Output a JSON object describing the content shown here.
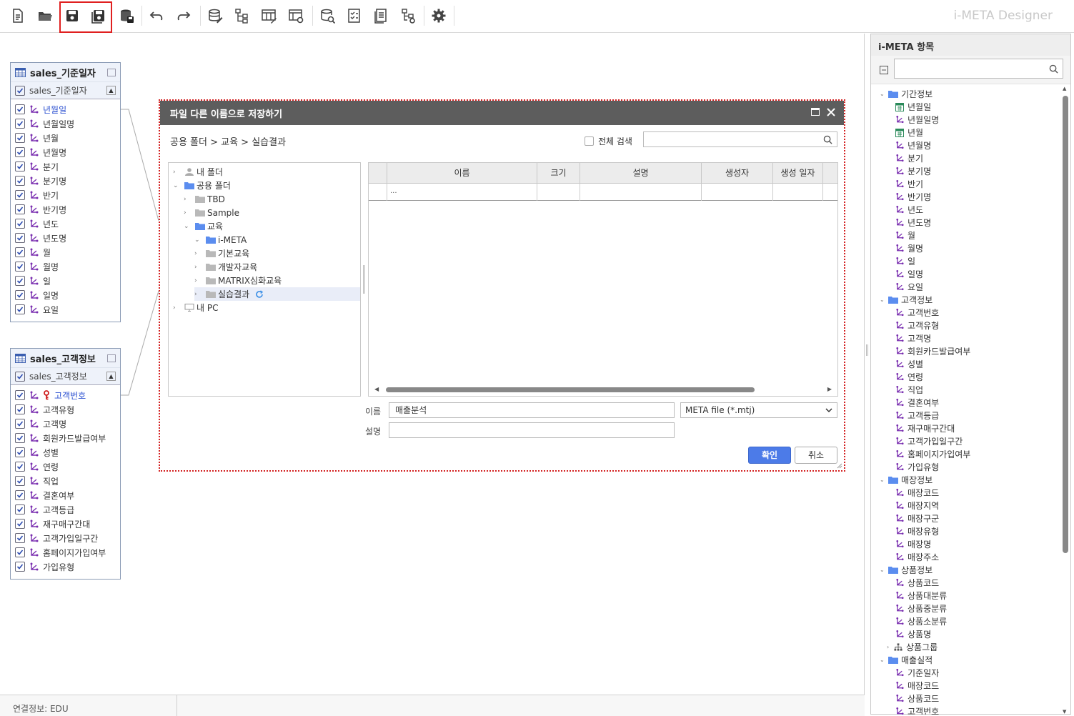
{
  "app": {
    "title": "i-META Designer"
  },
  "toolbar": {
    "buttons": [
      {
        "name": "new-file-icon"
      },
      {
        "name": "open-folder-icon"
      },
      {
        "name": "save-icon"
      },
      {
        "name": "save-as-icon"
      },
      {
        "name": "save-db-icon"
      },
      {
        "name": "undo-icon"
      },
      {
        "name": "redo-icon"
      },
      {
        "name": "database-edit-icon"
      },
      {
        "name": "hierarchy-icon"
      },
      {
        "name": "table-edit-icon"
      },
      {
        "name": "table-settings-icon"
      },
      {
        "name": "db-search-icon"
      },
      {
        "name": "checklist-icon"
      },
      {
        "name": "document-icon"
      },
      {
        "name": "tree-settings-icon"
      },
      {
        "name": "gear-icon"
      }
    ]
  },
  "entities": [
    {
      "title": "sales_기준일자",
      "subtitle": "sales_기준일자",
      "fields": [
        "년월일",
        "년월일명",
        "년월",
        "년월명",
        "분기",
        "분기명",
        "반기",
        "반기명",
        "년도",
        "년도명",
        "월",
        "월명",
        "일",
        "일명",
        "요일"
      ]
    },
    {
      "title": "sales_고객정보",
      "subtitle": "sales_고객정보",
      "fields": [
        "고객번호",
        "고객유형",
        "고객명",
        "회원카드발급여부",
        "성별",
        "연령",
        "직업",
        "결혼여부",
        "고객등급",
        "재구매구간대",
        "고객가입일구간",
        "홈페이지가입여부",
        "가입유형"
      ]
    }
  ],
  "dialog": {
    "title": "파일 다른 이름으로 저장하기",
    "path": "공용 폴더 > 교육 > 실습결과",
    "full_search_label": "전체 검색",
    "tree": [
      {
        "label": "내 폴더",
        "level": 0,
        "chev": "›",
        "icon": "user"
      },
      {
        "label": "공용 폴더",
        "level": 0,
        "chev": "⌄",
        "icon": "folder-blue"
      },
      {
        "label": "TBD",
        "level": 1,
        "chev": "›",
        "icon": "folder-gray"
      },
      {
        "label": "Sample",
        "level": 1,
        "chev": "›",
        "icon": "folder-gray"
      },
      {
        "label": "교육",
        "level": 1,
        "chev": "⌄",
        "icon": "folder-blue"
      },
      {
        "label": "i-META",
        "level": 2,
        "chev": "⌄",
        "icon": "folder-blue"
      },
      {
        "label": "기본교육",
        "level": 2,
        "chev": "›",
        "icon": "folder-gray"
      },
      {
        "label": "개발자교육",
        "level": 2,
        "chev": "›",
        "icon": "folder-gray"
      },
      {
        "label": "MATRIX심화교육",
        "level": 2,
        "chev": "›",
        "icon": "folder-gray"
      },
      {
        "label": "실습결과",
        "level": 2,
        "chev": "›",
        "icon": "folder-gray",
        "selected": true
      },
      {
        "label": "내 PC",
        "level": 0,
        "chev": "›",
        "icon": "pc"
      }
    ],
    "grid": {
      "columns": [
        "이름",
        "크기",
        "설명",
        "생성자",
        "생성 일자"
      ],
      "parent_row": "..."
    },
    "name_label": "이름",
    "name_value": "매출분석",
    "type_value": "META file (*.mtj)",
    "desc_label": "설명",
    "ok_label": "확인",
    "cancel_label": "취소"
  },
  "right_panel": {
    "title": "i-META 항목",
    "groups": [
      {
        "label": "기간정보",
        "items": [
          "년월일",
          "년월일명",
          "년월",
          "년월명",
          "분기",
          "분기명",
          "반기",
          "반기명",
          "년도",
          "년도명",
          "월",
          "월명",
          "일",
          "일명",
          "요일"
        ]
      },
      {
        "label": "고객정보",
        "items": [
          "고객번호",
          "고객유형",
          "고객명",
          "회원카드발급여부",
          "성별",
          "연령",
          "직업",
          "결혼여부",
          "고객등급",
          "재구매구간대",
          "고객가입일구간",
          "홈페이지가입여부",
          "가입유형"
        ]
      },
      {
        "label": "매장정보",
        "items": [
          "매장코드",
          "매장지역",
          "매장구군",
          "매장유형",
          "매장명",
          "매장주소"
        ]
      },
      {
        "label": "상품정보",
        "items": [
          "상품코드",
          "상품대분류",
          "상품중분류",
          "상품소분류",
          "상품명"
        ],
        "subgroup": "상품그룹"
      },
      {
        "label": "매출실적",
        "items": [
          "기준일자",
          "매장코드",
          "상품코드",
          "고객번호"
        ]
      }
    ]
  },
  "status": {
    "connection": "연결정보: EDU"
  }
}
